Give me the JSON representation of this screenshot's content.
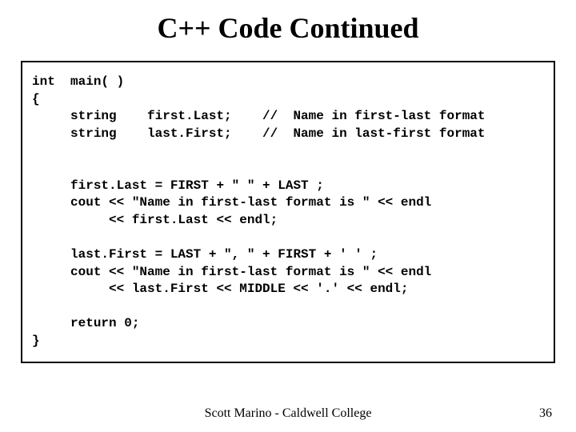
{
  "title": "C++ Code Continued",
  "code": "int  main( )\n{\n     string    first.Last;    //  Name in first-last format\n     string    last.First;    //  Name in last-first format\n\n\n     first.Last = FIRST + \" \" + LAST ;\n     cout << \"Name in first-last format is \" << endl\n          << first.Last << endl;\n\n     last.First = LAST + \", \" + FIRST + ' ' ;\n     cout << \"Name in first-last format is \" << endl\n          << last.First << MIDDLE << '.' << endl;\n\n     return 0;\n}",
  "footer_left": "Scott Marino - Caldwell College",
  "footer_right": "36"
}
